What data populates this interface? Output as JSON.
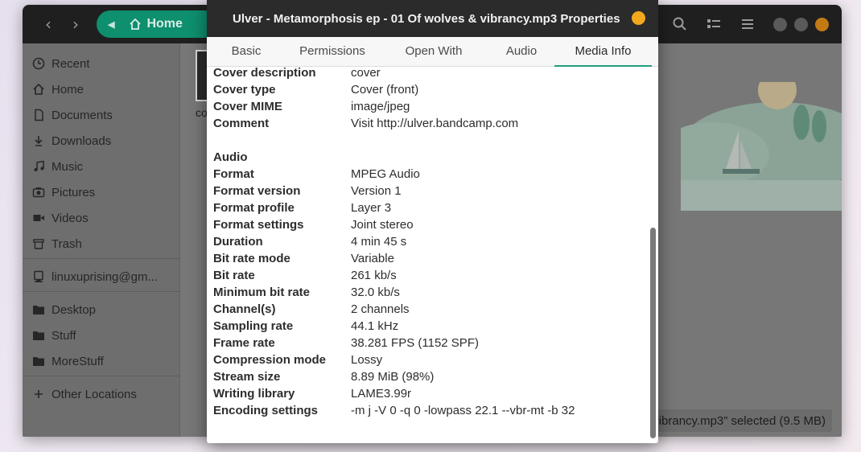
{
  "background_window": {
    "path_label": "Home",
    "sidebar": [
      {
        "label": "Recent",
        "icon": "clock-icon"
      },
      {
        "label": "Home",
        "icon": "home-icon"
      },
      {
        "label": "Documents",
        "icon": "document-icon"
      },
      {
        "label": "Downloads",
        "icon": "download-icon"
      },
      {
        "label": "Music",
        "icon": "music-icon"
      },
      {
        "label": "Pictures",
        "icon": "camera-icon"
      },
      {
        "label": "Videos",
        "icon": "video-icon"
      },
      {
        "label": "Trash",
        "icon": "trash-icon"
      },
      {
        "label": "linuxuprising@gm...",
        "icon": "account-icon"
      },
      {
        "label": "Desktop",
        "icon": "folder-icon"
      },
      {
        "label": "Stuff",
        "icon": "folder-icon"
      },
      {
        "label": "MoreStuff",
        "icon": "folder-icon"
      },
      {
        "label": "Other Locations",
        "icon": "plus-icon"
      }
    ],
    "file_label": "co",
    "status_text": "vibrancy.mp3” selected  (9.5 MB)"
  },
  "dialog": {
    "title": "Ulver - Metamorphosis ep - 01 Of wolves & vibrancy.mp3 Properties",
    "tabs": [
      "Basic",
      "Permissions",
      "Open With",
      "Audio",
      "Media Info"
    ],
    "active_tab": "Media Info",
    "rows": [
      {
        "key": "Cover description",
        "value": "cover"
      },
      {
        "key": "Cover type",
        "value": "Cover (front)"
      },
      {
        "key": "Cover MIME",
        "value": "image/jpeg"
      },
      {
        "key": "Comment",
        "value": "Visit http://ulver.bandcamp.com"
      },
      {
        "key": "",
        "value": ""
      },
      {
        "key": "Audio",
        "value": ""
      },
      {
        "key": "Format",
        "value": "MPEG Audio"
      },
      {
        "key": "Format version",
        "value": "Version 1"
      },
      {
        "key": "Format profile",
        "value": "Layer 3"
      },
      {
        "key": "Format settings",
        "value": "Joint stereo"
      },
      {
        "key": "Duration",
        "value": "4 min 45 s"
      },
      {
        "key": "Bit rate mode",
        "value": "Variable"
      },
      {
        "key": "Bit rate",
        "value": "261 kb/s"
      },
      {
        "key": "Minimum bit rate",
        "value": "32.0 kb/s"
      },
      {
        "key": "Channel(s)",
        "value": "2 channels"
      },
      {
        "key": "Sampling rate",
        "value": "44.1 kHz"
      },
      {
        "key": "Frame rate",
        "value": "38.281 FPS (1152 SPF)"
      },
      {
        "key": "Compression mode",
        "value": "Lossy"
      },
      {
        "key": "Stream size",
        "value": "8.89 MiB (98%)"
      },
      {
        "key": "Writing library",
        "value": "LAME3.99r"
      },
      {
        "key": "Encoding settings",
        "value": "-m j -V 0 -q 0 -lowpass 22.1 --vbr-mt -b 32"
      }
    ]
  },
  "colors": {
    "accent": "#1f9f7d",
    "path_pill": "#0e8f6e",
    "close_button": "#f2a81d",
    "titlebar": "#2b2b2b"
  }
}
